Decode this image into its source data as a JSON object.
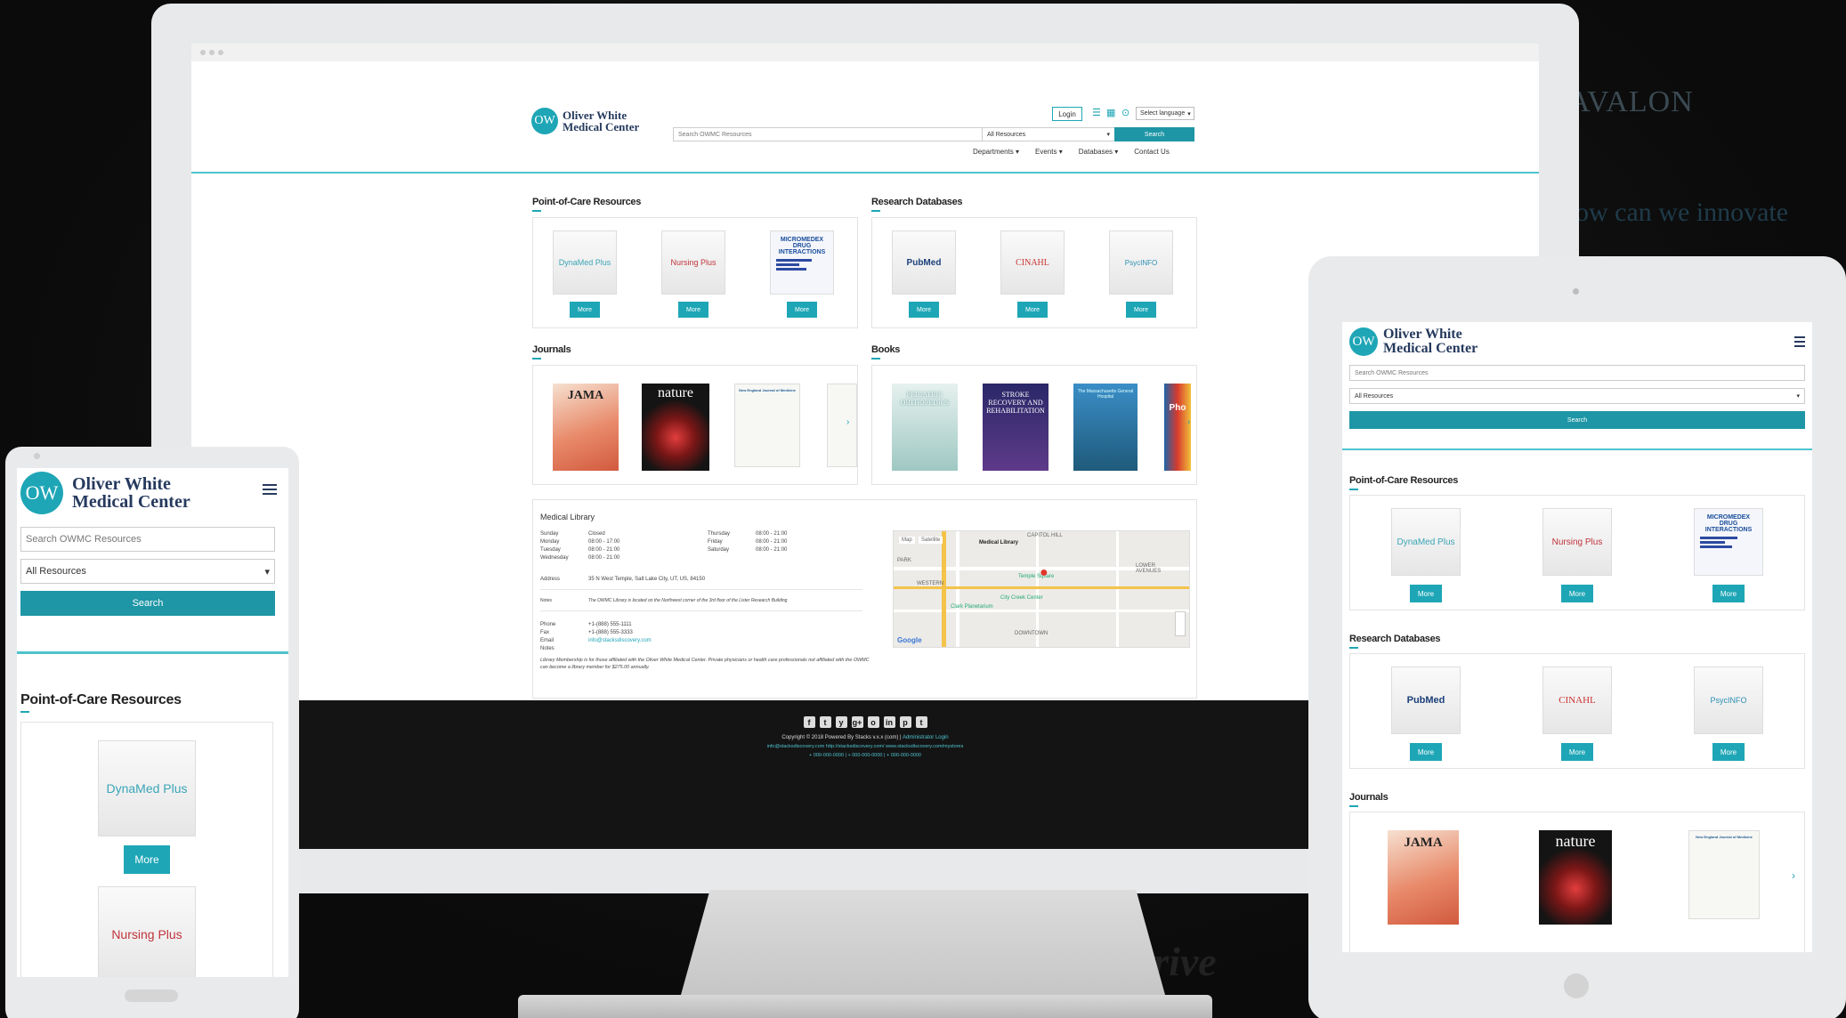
{
  "brand": {
    "initials": "OW",
    "name_line1": "Oliver White",
    "name_line2": "Medical Center"
  },
  "search": {
    "placeholder": "Search OWMC Resources",
    "scope_value": "All Resources",
    "button_label": "Search"
  },
  "header": {
    "login_label": "Login",
    "language_label": "Select language",
    "icons": [
      "database-icon",
      "calendar-icon",
      "help-icon"
    ]
  },
  "nav": [
    {
      "label": "Departments",
      "dropdown": true
    },
    {
      "label": "Events",
      "dropdown": true
    },
    {
      "label": "Databases",
      "dropdown": true
    },
    {
      "label": "Contact Us",
      "dropdown": false
    }
  ],
  "point_of_care": {
    "title": "Point-of-Care Resources",
    "items": [
      {
        "name": "DynaMed Plus",
        "more": "More"
      },
      {
        "name": "Nursing Plus",
        "more": "More"
      },
      {
        "name": "MICROMEDEX DRUG INTERACTIONS",
        "more": "More"
      }
    ]
  },
  "research": {
    "title": "Research Databases",
    "items": [
      {
        "name": "PubMed",
        "more": "More"
      },
      {
        "name": "CINAHL",
        "more": "More"
      },
      {
        "name": "PsycINFO",
        "more": "More"
      }
    ]
  },
  "journals": {
    "title": "Journals",
    "covers": [
      "JAMA",
      "nature",
      "New England Journal of Medicine"
    ]
  },
  "books": {
    "title": "Books",
    "covers": [
      "PEDIATRIC ORTHOPEDICS",
      "STROKE RECOVERY AND REHABILITATION",
      "The Massachusetts General Hospital",
      "Pho"
    ]
  },
  "library": {
    "title": "Medical Library",
    "hours_left": [
      [
        "Sunday",
        "Closed"
      ],
      [
        "Monday",
        "08:00 - 17:00"
      ],
      [
        "Tuesday",
        "08:00 - 21:00"
      ],
      [
        "Wednesday",
        "08:00 - 21:00"
      ]
    ],
    "hours_right": [
      [
        "Thursday",
        "08:00 - 21:00"
      ],
      [
        "Friday",
        "08:00 - 21:00"
      ],
      [
        "Saturday",
        "08:00 - 21:00"
      ]
    ],
    "address_label": "Address",
    "address": "35 N West Temple, Salt Lake City, UT, US, 84150",
    "notes_label": "Notes",
    "notes": "The OWMC Library is located on the Northwest corner of the 3rd floor of the Lister Research Building",
    "phone_label": "Phone",
    "phone": "+1-(888) 555-1111",
    "fax_label": "Fax",
    "fax": "+1-(888) 555-3333",
    "email_label": "Email",
    "email": "info@stacksdiscovery.com",
    "notes2_label": "Notes",
    "membership": "Library Membership is for those affiliated with the Oliver White Medical Center. Private physicians or health care professionals not affiliated with the OWMC can become a library member for $275.00 annually."
  },
  "map": {
    "mode_map": "Map",
    "mode_sat": "Satellite",
    "pin_label": "Medical Library",
    "areas": [
      "CAPITOL HILL",
      "PARK",
      "WESTERN",
      "DOWNTOWN",
      "LOWER AVENUES",
      "Temple Square",
      "City Creek Center",
      "Clark Planetarium"
    ],
    "provider": "Google"
  },
  "footer": {
    "social": [
      "f",
      "t",
      "y",
      "g+",
      "o",
      "in",
      "p",
      "t"
    ],
    "copyright": "Copyright © 2018 Powered By Stacks v.x.x (com)",
    "admin": "Administrator Login",
    "contact": "info@stacksdiscovery.com  http://stacksdiscovery.com/  www.stacksdiscovery.com/mystores",
    "phones": "+ 000-000-0000  |  + 000-000-0000  |  + 000-000-0000"
  },
  "background": {
    "avalon": "AVALON",
    "headline": "ow can we innovate",
    "overdrive": "OverDrive"
  }
}
